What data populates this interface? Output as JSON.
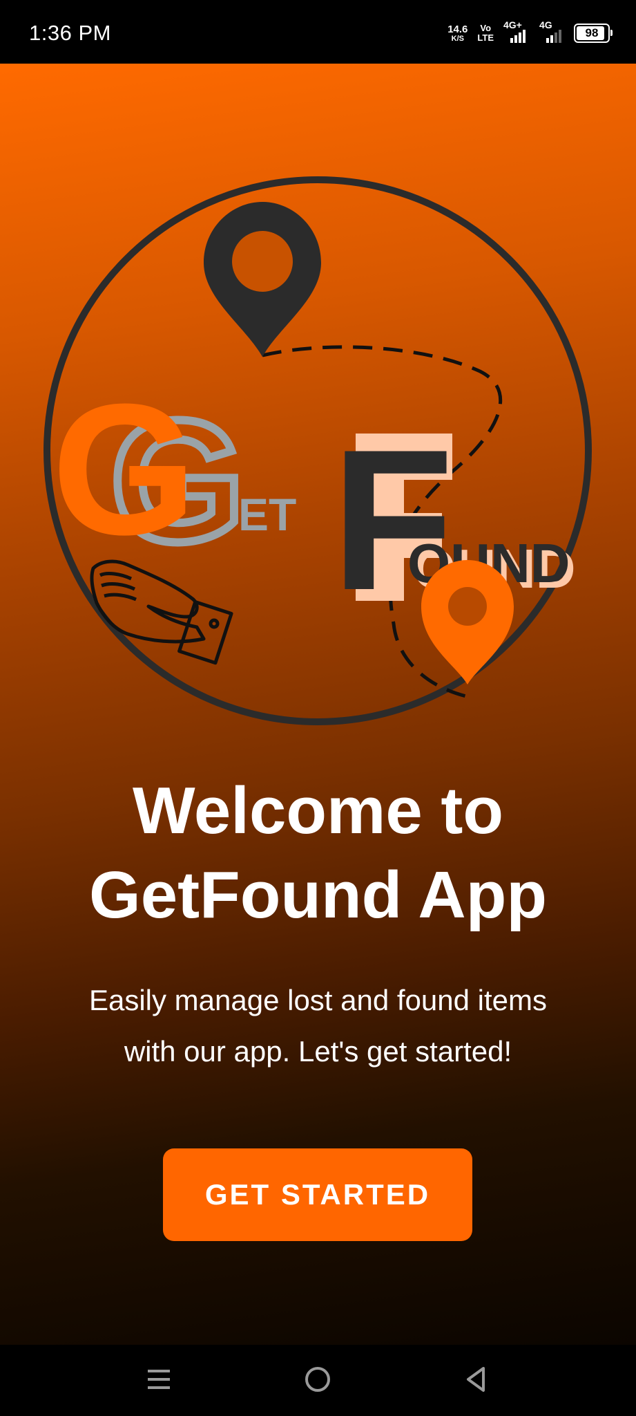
{
  "status_bar": {
    "time": "1:36 PM",
    "net_speed_value": "14.6",
    "net_speed_unit": "K/S",
    "volte_top": "Vo",
    "volte_bottom": "LTE",
    "sim1_label": "4G+",
    "sim2_label": "4G",
    "battery_level": "98"
  },
  "logo": {
    "big_letter_1": "G",
    "word_1_rest": "ET",
    "big_letter_2": "F",
    "word_2_rest": "OUND",
    "colors": {
      "orange": "#ff6a00",
      "dark": "#2b2b2b",
      "grey": "#9aa3a8",
      "peach": "#ffc9a8"
    }
  },
  "welcome": {
    "title_line1": "Welcome to",
    "title_line2": "GetFound App",
    "subtitle_line1": "Easily manage lost and found items",
    "subtitle_line2": "with our app. Let's get started!"
  },
  "cta": {
    "label": "GET STARTED",
    "color": "#ff6600"
  },
  "nav_bar": {
    "icons": [
      "menu-icon",
      "home-circle-icon",
      "back-triangle-icon"
    ]
  }
}
